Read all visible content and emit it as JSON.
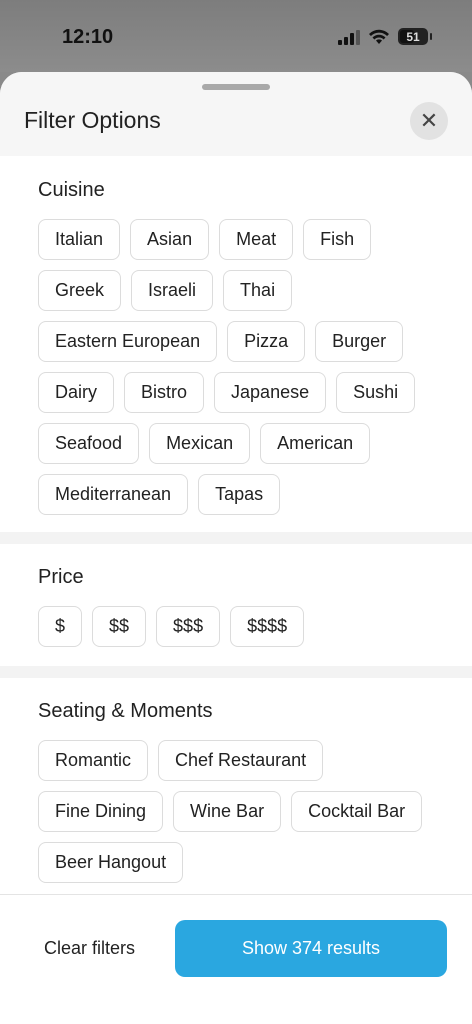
{
  "status_bar": {
    "time": "12:10",
    "battery": "51"
  },
  "sheet": {
    "title": "Filter Options",
    "close_icon": "close-icon"
  },
  "sections": {
    "cuisine": {
      "title": "Cuisine",
      "options": [
        "Italian",
        "Asian",
        "Meat",
        "Fish",
        "Greek",
        "Israeli",
        "Thai",
        "Eastern European",
        "Pizza",
        "Burger",
        "Dairy",
        "Bistro",
        "Japanese",
        "Sushi",
        "Seafood",
        "Mexican",
        "American",
        "Mediterranean",
        "Tapas"
      ]
    },
    "price": {
      "title": "Price",
      "options": [
        "$",
        "$$",
        "$$$",
        "$$$$"
      ]
    },
    "seating": {
      "title": "Seating & Moments",
      "options": [
        "Romantic",
        "Chef Restaurant",
        "Fine Dining",
        "Wine Bar",
        "Cocktail Bar",
        "Beer Hangout"
      ]
    }
  },
  "footer": {
    "clear_label": "Clear filters",
    "show_label": "Show 374 results"
  }
}
